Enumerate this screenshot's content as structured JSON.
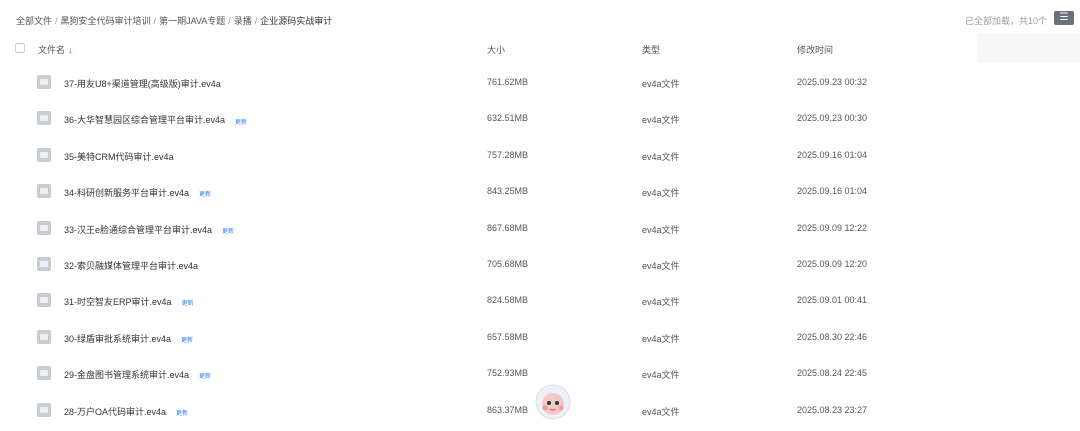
{
  "breadcrumb": {
    "items": [
      "全部文件",
      "黑狗安全代码审计培训",
      "第一期JAVA专题",
      "录播"
    ],
    "current": "企业源码实战审计"
  },
  "status": {
    "loaded_text": "已全部加载，共10个"
  },
  "icons": {
    "list_view": "list-view-icon",
    "file": "video-file-icon",
    "sort": "sort-arrow-icon"
  },
  "colors": {
    "accent": "#2a7cff",
    "badge": "#2a7cff"
  },
  "columns": {
    "name": "文件名",
    "size": "大小",
    "type": "类型",
    "modified": "修改时间"
  },
  "files": [
    {
      "name": "37-用友U8+渠道管理(高级版)审计.ev4a",
      "badge": "",
      "size": "761.62MB",
      "type": "ev4a文件",
      "modified": "2025.09.23 00:32"
    },
    {
      "name": "36-大华智慧园区综合管理平台审计.ev4a",
      "badge": "更新",
      "size": "632.51MB",
      "type": "ev4a文件",
      "modified": "2025.09.23 00:30"
    },
    {
      "name": "35-美特CRM代码审计.ev4a",
      "badge": "",
      "size": "757.28MB",
      "type": "ev4a文件",
      "modified": "2025.09.16 01:04"
    },
    {
      "name": "34-科研创新服务平台审计.ev4a",
      "badge": "更新",
      "size": "843.25MB",
      "type": "ev4a文件",
      "modified": "2025.09.16 01:04"
    },
    {
      "name": "33-汉王e脸通综合管理平台审计.ev4a",
      "badge": "更新",
      "size": "867.68MB",
      "type": "ev4a文件",
      "modified": "2025.09.09 12:22"
    },
    {
      "name": "32-索贝融媒体管理平台审计.ev4a",
      "badge": "",
      "size": "705.68MB",
      "type": "ev4a文件",
      "modified": "2025.09.09 12:20"
    },
    {
      "name": "31-时空智友ERP审计.ev4a",
      "badge": "更新",
      "size": "824.58MB",
      "type": "ev4a文件",
      "modified": "2025.09.01 00:41"
    },
    {
      "name": "30-绿盾审批系统审计.ev4a",
      "badge": "更新",
      "size": "657.58MB",
      "type": "ev4a文件",
      "modified": "2025.08.30 22:46"
    },
    {
      "name": "29-金盘图书管理系统审计.ev4a",
      "badge": "更新",
      "size": "752.93MB",
      "type": "ev4a文件",
      "modified": "2025.08.24 22:45"
    },
    {
      "name": "28-万户OA代码审计.ev4a",
      "badge": "更新",
      "size": "863.37MB",
      "type": "ev4a文件",
      "modified": "2025.08.23 23:27"
    }
  ]
}
